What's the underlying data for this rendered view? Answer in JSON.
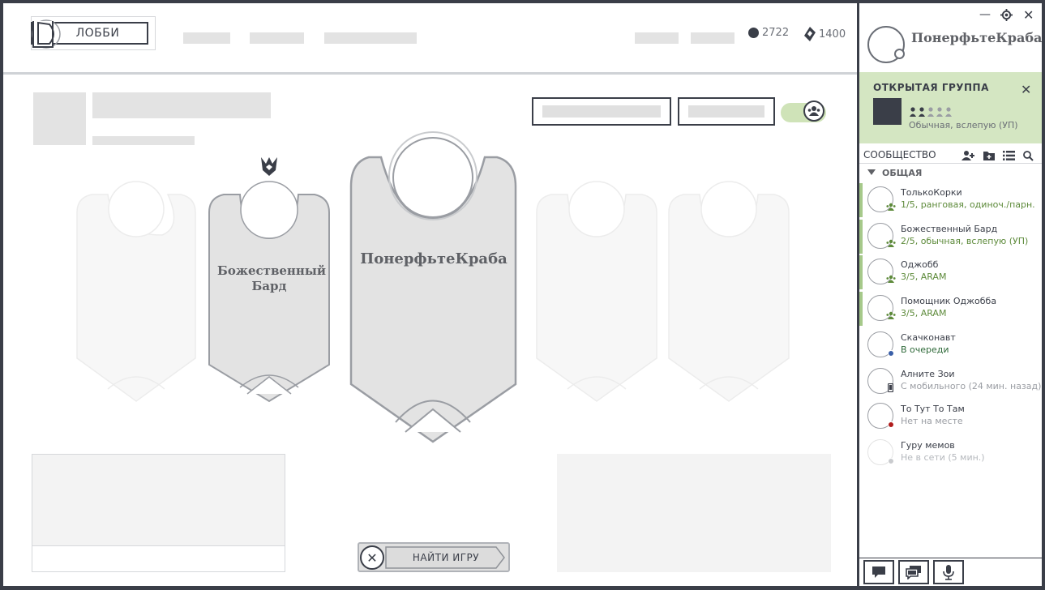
{
  "nav": {
    "lobby_label": "ЛОББИ",
    "blue_essence": "2722",
    "riot_points": "1400"
  },
  "lobby": {
    "banners": [
      {
        "name": ""
      },
      {
        "name": "Божественный Бард"
      },
      {
        "name": "ПонерфьтеКраба"
      },
      {
        "name": ""
      },
      {
        "name": ""
      }
    ],
    "find_game_label": "НАЙТИ ИГРУ"
  },
  "social": {
    "me_name": "ПонерфьтеКраба",
    "group": {
      "title": "ОТКРЫТАЯ ГРУППА",
      "subtitle": "Обычная, вслепую (УП)",
      "filled_slots": 2,
      "total_slots": 5
    },
    "community_label": "СООБЩЕСТВО",
    "category_label": "ОБЩАЯ",
    "friends": [
      {
        "name": "ТолькоКорки",
        "detail": "1/5, ранговая, одиноч./парн.",
        "status": "in-group",
        "color": "#5d8a3a"
      },
      {
        "name": "Божественный Бард",
        "detail": "2/5, обычная, вслепую (УП)",
        "status": "in-group",
        "color": "#5d8a3a"
      },
      {
        "name": "Оджобб",
        "detail": "3/5, ARAM",
        "status": "in-group",
        "color": "#5d8a3a"
      },
      {
        "name": "Помощник Оджобба",
        "detail": "3/5, ARAM",
        "status": "in-group",
        "color": "#5d8a3a"
      },
      {
        "name": "Скачконавт",
        "detail": "В очереди",
        "status": "queue",
        "color": "#2f6a3a"
      },
      {
        "name": "Алните Зои",
        "detail": "С мобильного (24 мин. назад)",
        "status": "mobile",
        "color": "#9a9da3"
      },
      {
        "name": "То Тут То Там",
        "detail": "Нет на месте",
        "status": "away",
        "color": "#9a9da3"
      },
      {
        "name": "Гуру мемов",
        "detail": "Не в сети (5 мин.)",
        "status": "offline",
        "color": "#9a9da3"
      }
    ]
  }
}
